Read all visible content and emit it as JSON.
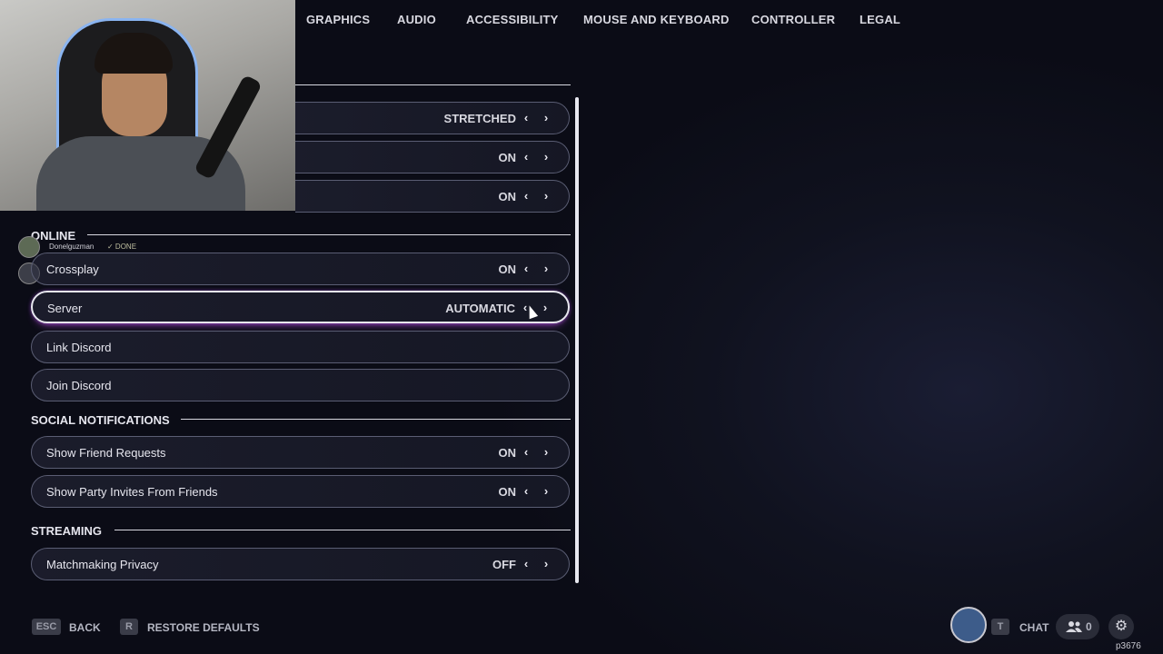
{
  "nav": {
    "tabs": [
      "GRAPHICS",
      "AUDIO",
      "ACCESSIBILITY",
      "MOUSE AND KEYBOARD",
      "CONTROLLER",
      "LEGAL"
    ]
  },
  "partial_rows": [
    {
      "value": "STRETCHED"
    },
    {
      "value": "ON"
    },
    {
      "value": "ON"
    }
  ],
  "sections": {
    "online": "ONLINE",
    "social": "SOCIAL NOTIFICATIONS",
    "streaming": "STREAMING"
  },
  "overlay": {
    "username": "Donelguzman",
    "status": "✓ DONE"
  },
  "online_rows": [
    {
      "label": "Crossplay",
      "value": "ON"
    },
    {
      "label": "Server",
      "value": "AUTOMATIC"
    },
    {
      "label": "Link Discord"
    },
    {
      "label": "Join Discord"
    }
  ],
  "social_rows": [
    {
      "label": "Show Friend Requests",
      "value": "ON"
    },
    {
      "label": "Show Party Invites From Friends",
      "value": "ON"
    }
  ],
  "streaming_rows": [
    {
      "label": "Matchmaking Privacy",
      "value": "OFF"
    }
  ],
  "arrows": {
    "left": "‹",
    "right": "›"
  },
  "bottom": {
    "esc_key": "ESC",
    "back": "BACK",
    "r_key": "R",
    "restore": "RESTORE DEFAULTS",
    "t_key": "T",
    "chat": "CHAT",
    "friends_count": "0",
    "gear": "⚙"
  },
  "watermark": "p3676",
  "icons": {
    "left_arrow": "chevron-left-icon",
    "right_arrow": "chevron-right-icon",
    "friends": "friends-icon",
    "settings": "gear-icon"
  },
  "colors": {
    "active_glow": "#b04ad8",
    "background": "#10121f"
  }
}
